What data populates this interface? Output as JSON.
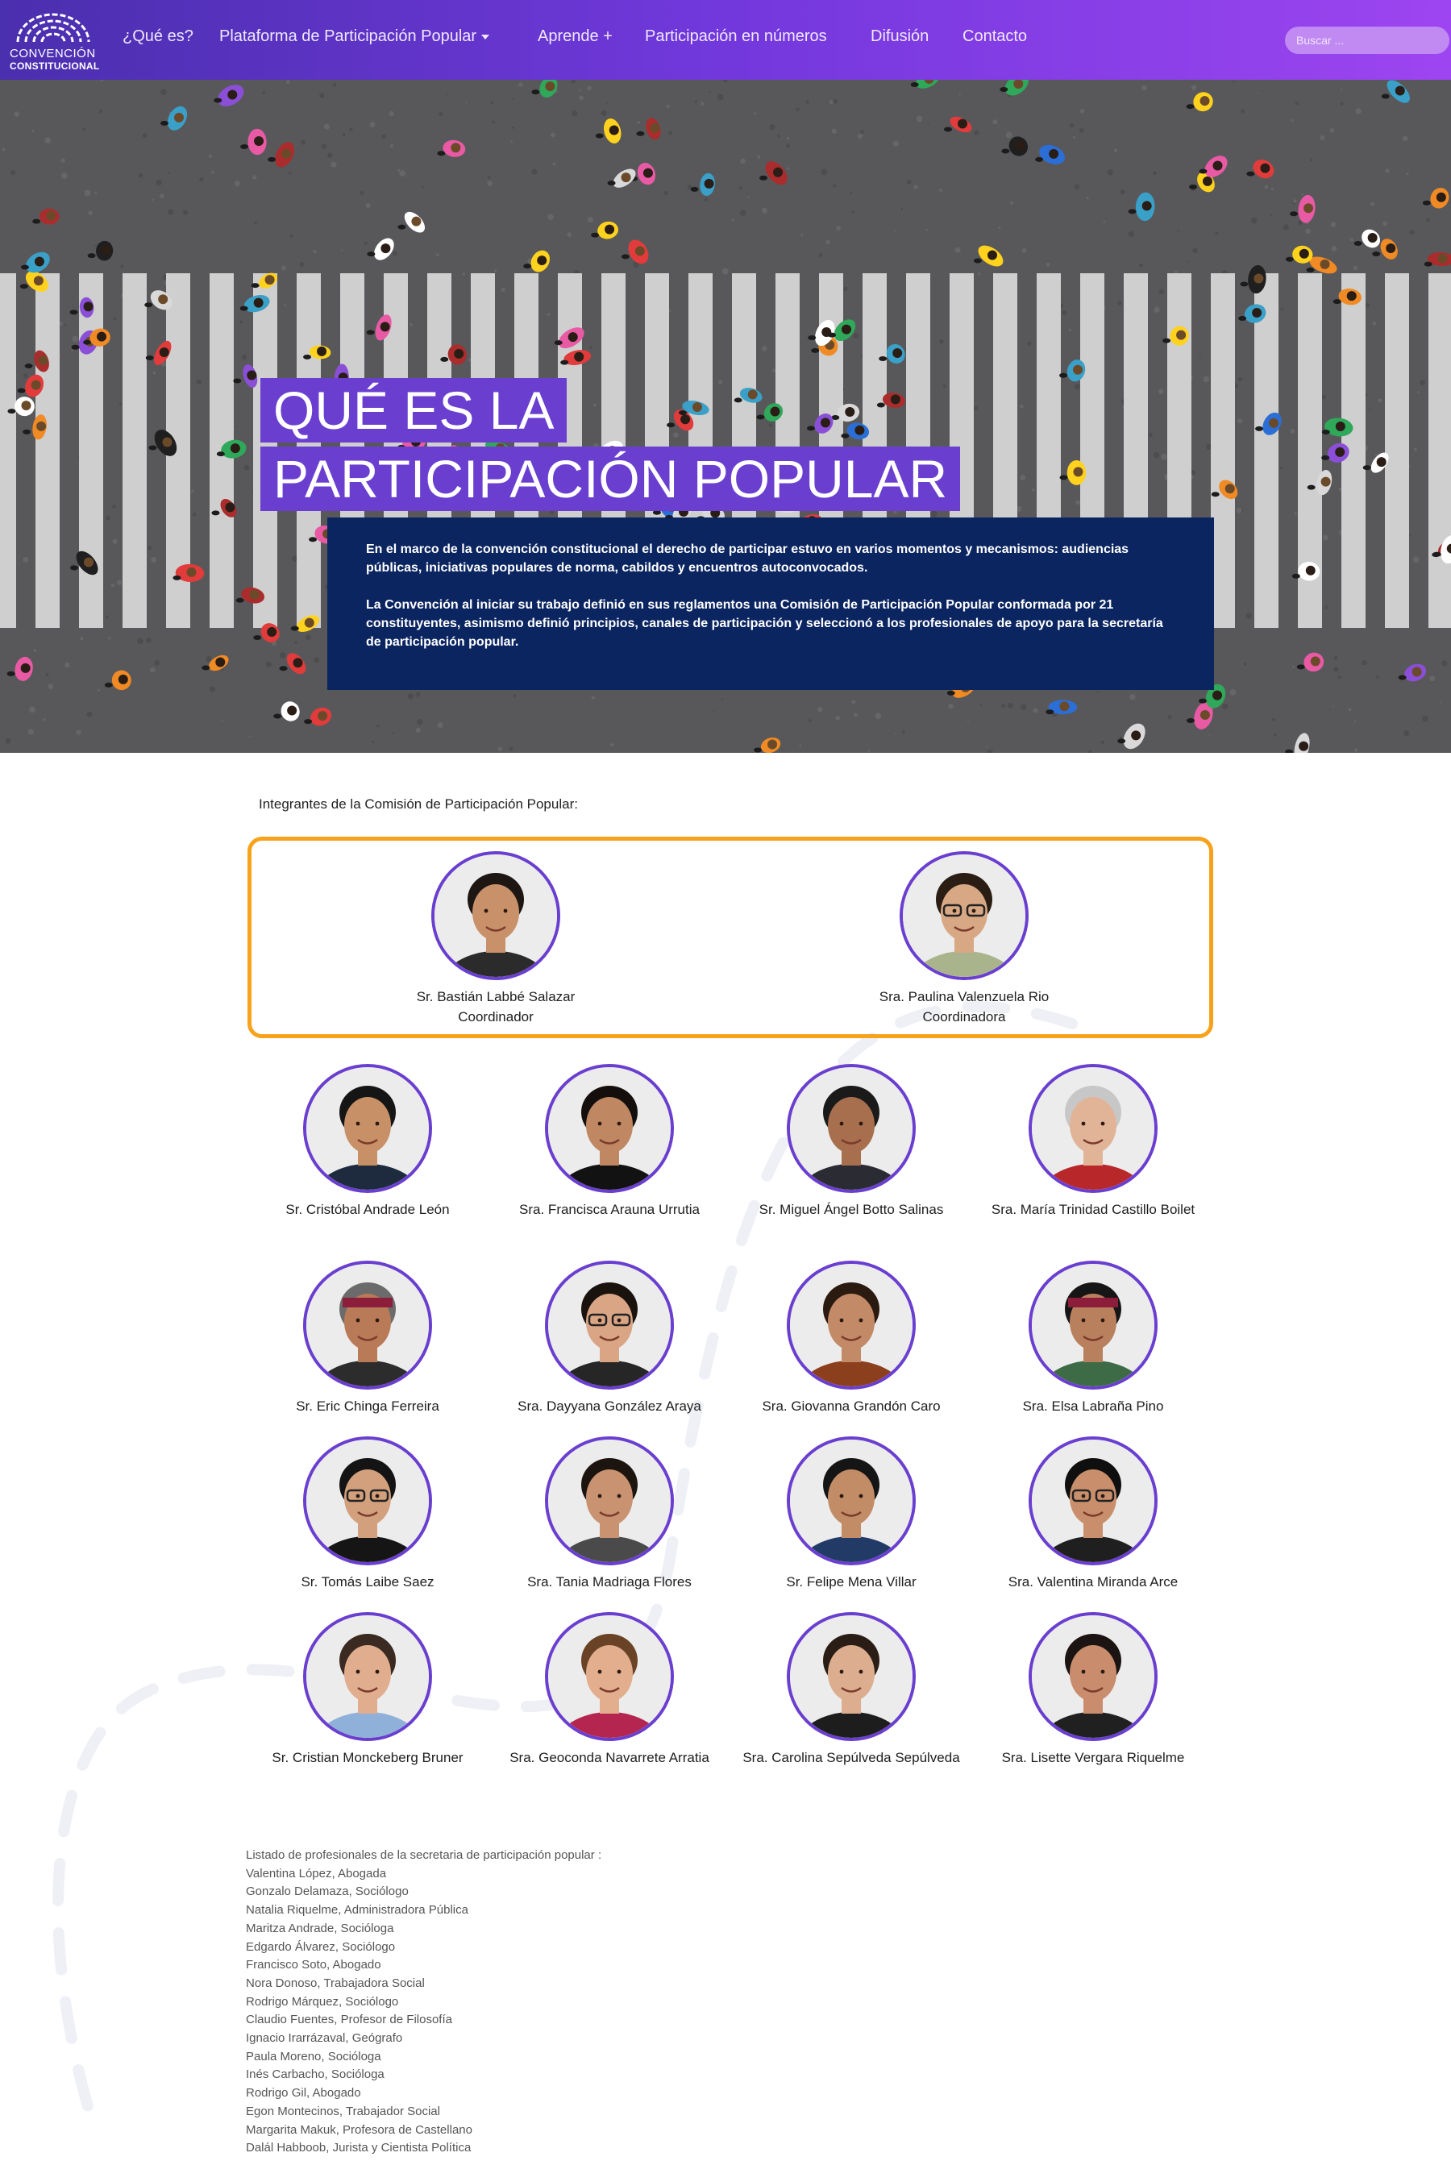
{
  "nav": {
    "logo_line1": "CONVENCIÓN",
    "logo_line2": "CONSTITUCIONAL",
    "items": [
      {
        "label": "¿Qué es?"
      },
      {
        "label": "Plataforma de Participación Popular"
      },
      {
        "label": "Aprende +"
      },
      {
        "label": "Participación en números"
      },
      {
        "label": "Difusión"
      },
      {
        "label": "Contacto"
      }
    ],
    "search_placeholder": "Buscar ..."
  },
  "hero": {
    "title_line1": "QUÉ ES LA",
    "title_line2": "PARTICIPACIÓN POPULAR",
    "paragraph1": "En el marco de la convención constitucional el derecho de participar estuvo en varios momentos y mecanismos: audiencias públicas, iniciativas populares de norma, cabildos y encuentros autoconvocados.",
    "paragraph2": "La Convención al iniciar su trabajo definió en sus reglamentos una Comisión de Participación Popular conformada por 21 constituyentes, asimismo definió principios, canales de participación y seleccionó a los profesionales de apoyo para la secretaría de participación popular."
  },
  "commission": {
    "intro": "Integrantes de la Comisión de Participación Popular:",
    "coordinators": [
      {
        "name": "Sr. Bastián Labbé Salazar",
        "role": "Coordinador"
      },
      {
        "name": "Sra. Paulina Valenzuela Rio",
        "role": "Coordinadora"
      }
    ],
    "members": [
      {
        "name": "Sr. Cristóbal Andrade León"
      },
      {
        "name": "Sra. Francisca Arauna Urrutia"
      },
      {
        "name": "Sr. Miguel Ángel Botto Salinas"
      },
      {
        "name": "Sra. María Trinidad Castillo Boilet"
      },
      {
        "name": "Sr. Eric Chinga Ferreira"
      },
      {
        "name": "Sra. Dayyana González Araya"
      },
      {
        "name": "Sra. Giovanna Grandón Caro"
      },
      {
        "name": "Sra. Elsa Labraña Pino"
      },
      {
        "name": "Sr. Tomás Laibe Saez"
      },
      {
        "name": "Sra. Tania Madriaga Flores"
      },
      {
        "name": "Sr. Felipe Mena Villar"
      },
      {
        "name": "Sra. Valentina Miranda Arce"
      },
      {
        "name": "Sr. Cristian Monckeberg Bruner"
      },
      {
        "name": "Sra. Geoconda Navarrete Arratia"
      },
      {
        "name": "Sra. Carolina Sepúlveda Sepúlveda"
      },
      {
        "name": "Sra. Lisette Vergara Riquelme"
      }
    ]
  },
  "staff": {
    "heading": "Listado de profesionales de la secretaria de participación popular :",
    "items": [
      "Valentina López, Abogada",
      "Gonzalo Delamaza, Sociólogo",
      "Natalia Riquelme, Administradora Pública",
      "Maritza Andrade, Socióloga",
      "Edgardo Álvarez, Sociólogo",
      "Francisco Soto, Abogado",
      "Nora Donoso, Trabajadora Social",
      "Rodrigo Márquez, Sociólogo",
      "Claudio Fuentes, Profesor de Filosofía",
      "Ignacio Irarrázaval, Geógrafo",
      "Paula Moreno, Socióloga",
      "Inés Carbacho, Socióloga",
      "Rodrigo Gil, Abogado",
      "Egon Montecinos, Trabajador Social",
      "Margarita Makuk, Profesora de Castellano",
      "Dalál Habboob, Jurista y Cientista Política"
    ]
  },
  "colors": {
    "accent_purple": "#6a3fd0",
    "navy": "#0b2561",
    "highlight_orange": "#f7a21b"
  }
}
